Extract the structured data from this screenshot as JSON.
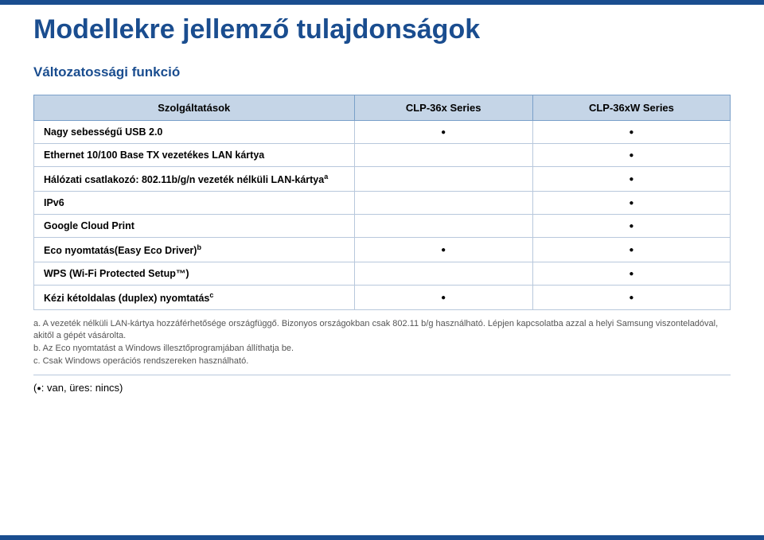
{
  "title": "Modellekre jellemző tulajdonságok",
  "subtitle": "Változatossági funkció",
  "table": {
    "headers": {
      "service": "Szolgáltatások",
      "col1": "CLP-36x Series",
      "col2": "CLP-36xW Series"
    },
    "rows": [
      {
        "label": "Nagy sebességű USB 2.0",
        "sup": "",
        "col1": "●",
        "col2": "●"
      },
      {
        "label": "Ethernet 10/100 Base TX vezetékes LAN kártya",
        "sup": "",
        "col1": "",
        "col2": "●"
      },
      {
        "label": "Hálózati csatlakozó: 802.11b/g/n vezeték nélküli LAN-kártya",
        "sup": "a",
        "col1": "",
        "col2": "●"
      },
      {
        "label": "IPv6",
        "sup": "",
        "col1": "",
        "col2": "●"
      },
      {
        "label": "Google Cloud Print",
        "sup": "",
        "col1": "",
        "col2": "●"
      },
      {
        "label": "Eco nyomtatás(Easy Eco Driver)",
        "sup": "b",
        "col1": "●",
        "col2": "●"
      },
      {
        "label": "WPS (Wi-Fi Protected Setup™)",
        "sup": "",
        "col1": "",
        "col2": "●"
      },
      {
        "label": "Kézi kétoldalas (duplex) nyomtatás",
        "sup": "c",
        "col1": "●",
        "col2": "●"
      }
    ]
  },
  "footnotes": {
    "a": "a. A vezeték nélküli LAN-kártya hozzáférhetősége országfüggő. Bizonyos országokban csak 802.11 b/g használható. Lépjen kapcsolatba azzal a helyi Samsung viszonteladóval, akitől a gépét vásárolta.",
    "b": "b. Az Eco nyomtatást a Windows illesztőprogramjában állíthatja be.",
    "c": "c. Csak Windows operációs rendszereken használható."
  },
  "legend": "(●: van, üres: nincs)"
}
